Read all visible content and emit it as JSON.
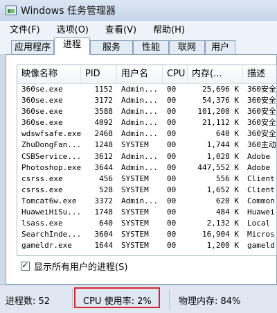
{
  "window": {
    "title": "Windows 任务管理器"
  },
  "menu": [
    "文件(F)",
    "选项(O)",
    "查看(V)",
    "帮助(H)"
  ],
  "tabs": [
    {
      "label": "应用程序",
      "active": false
    },
    {
      "label": "进程",
      "active": true
    },
    {
      "label": "服务",
      "active": false
    },
    {
      "label": "性能",
      "active": false
    },
    {
      "label": "联网",
      "active": false
    },
    {
      "label": "用户",
      "active": false
    }
  ],
  "processes": {
    "columns": [
      "映像名称",
      "PID",
      "用户名",
      "CPU",
      "内存(...",
      "描述"
    ],
    "rows": [
      [
        "360se.exe",
        "1152",
        "Admin...",
        "00",
        "25,696 K",
        "360安全"
      ],
      [
        "360se.exe",
        "3172",
        "Admin...",
        "00",
        "54,376 K",
        "360安全"
      ],
      [
        "360se.exe",
        "3588",
        "Admin...",
        "00",
        "101,200 K",
        "360安全"
      ],
      [
        "360se.exe",
        "4092",
        "Admin...",
        "00",
        "21,112 K",
        "360安全"
      ],
      [
        "wdswfsafe.exe",
        "2468",
        "Admin...",
        "00",
        "640 K",
        "360安全"
      ],
      [
        "ZhuDongFan...",
        "1248",
        "SYSTEM",
        "00",
        "1,744 K",
        "360主动"
      ],
      [
        "CSBService...",
        "3612",
        "Admin...",
        "00",
        "1,028 K",
        "Adobe"
      ],
      [
        "Photoshop.exe",
        "3644",
        "Admin...",
        "00",
        "447,552 K",
        "Adobe"
      ],
      [
        "csrss.exe",
        "456",
        "SYSTEM",
        "00",
        "556 K",
        "Client"
      ],
      [
        "csrss.exe",
        "528",
        "SYSTEM",
        "00",
        "1,652 K",
        "Client"
      ],
      [
        "Tomcat6w.exe",
        "3372",
        "Admin...",
        "00",
        "620 K",
        "Common"
      ],
      [
        "HuaweiHiSu...",
        "1748",
        "SYSTEM",
        "00",
        "484 K",
        "Huawei"
      ],
      [
        "lsass.exe",
        "640",
        "SYSTEM",
        "00",
        "2,132 K",
        "Local"
      ],
      [
        "SearchInde...",
        "3604",
        "SYSTEM",
        "00",
        "16,904 K",
        "Micros"
      ],
      [
        "gameldr.exe",
        "1644",
        "SYSTEM",
        "00",
        "1,200 K",
        "gameld"
      ]
    ]
  },
  "show_all_users": {
    "label": "显示所有用户的进程(S)",
    "checked": true
  },
  "status": {
    "processes": "进程数: 52",
    "cpu": "CPU 使用率: 2%",
    "memory": "物理内存: 84%"
  },
  "colors": {
    "highlight_border": "#d6242b"
  }
}
